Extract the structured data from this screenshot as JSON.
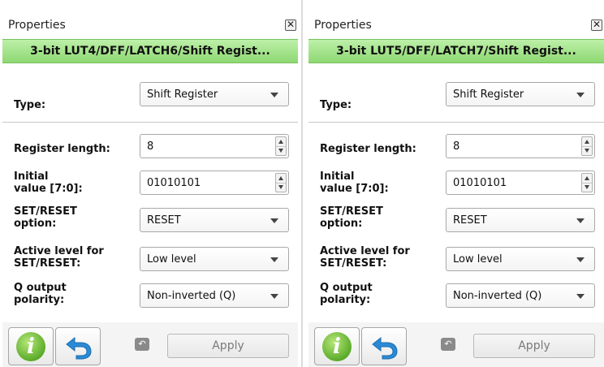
{
  "panels": [
    {
      "title": "Properties",
      "close_symbol": "✕",
      "header": "3-bit LUT4/DFF/LATCH6/Shift Regist...",
      "type_label": "Type:",
      "type_value": "Shift Register",
      "register_length_label": "Register length:",
      "register_length_value": "8",
      "initial_value_label_line1": "Initial",
      "initial_value_label_line2": "value [7:0]:",
      "initial_value": "01010101",
      "set_reset_label_line1": "SET/RESET",
      "set_reset_label_line2": "option:",
      "set_reset_value": "RESET",
      "active_level_label_line1": "Active level for",
      "active_level_label_line2": "SET/RESET:",
      "active_level_value": "Low level",
      "q_polarity_label_line1": "Q output",
      "q_polarity_label_line2": "polarity:",
      "q_polarity_value": "Non-inverted (Q)",
      "info_glyph": "i",
      "apply_label": "Apply"
    },
    {
      "title": "Properties",
      "close_symbol": "✕",
      "header": "3-bit LUT5/DFF/LATCH7/Shift Regist...",
      "type_label": "Type:",
      "type_value": "Shift Register",
      "register_length_label": "Register length:",
      "register_length_value": "8",
      "initial_value_label_line1": "Initial",
      "initial_value_label_line2": "value [7:0]:",
      "initial_value": "01010101",
      "set_reset_label_line1": "SET/RESET",
      "set_reset_label_line2": "option:",
      "set_reset_value": "RESET",
      "active_level_label_line1": "Active level for",
      "active_level_label_line2": "SET/RESET:",
      "active_level_value": "Low level",
      "q_polarity_label_line1": "Q output",
      "q_polarity_label_line2": "polarity:",
      "q_polarity_value": "Non-inverted (Q)",
      "info_glyph": "i",
      "apply_label": "Apply"
    }
  ],
  "colors": {
    "header_green": "#8ed873",
    "info_green": "#5cac2a",
    "undo_blue": "#2a8ad6"
  },
  "icons": {
    "close": "close-icon",
    "info": "info-icon",
    "undo": "undo-icon",
    "small_undo": "small-undo-icon",
    "dropdown": "chevron-down-icon",
    "spinner": "spinner-arrows-icon"
  }
}
